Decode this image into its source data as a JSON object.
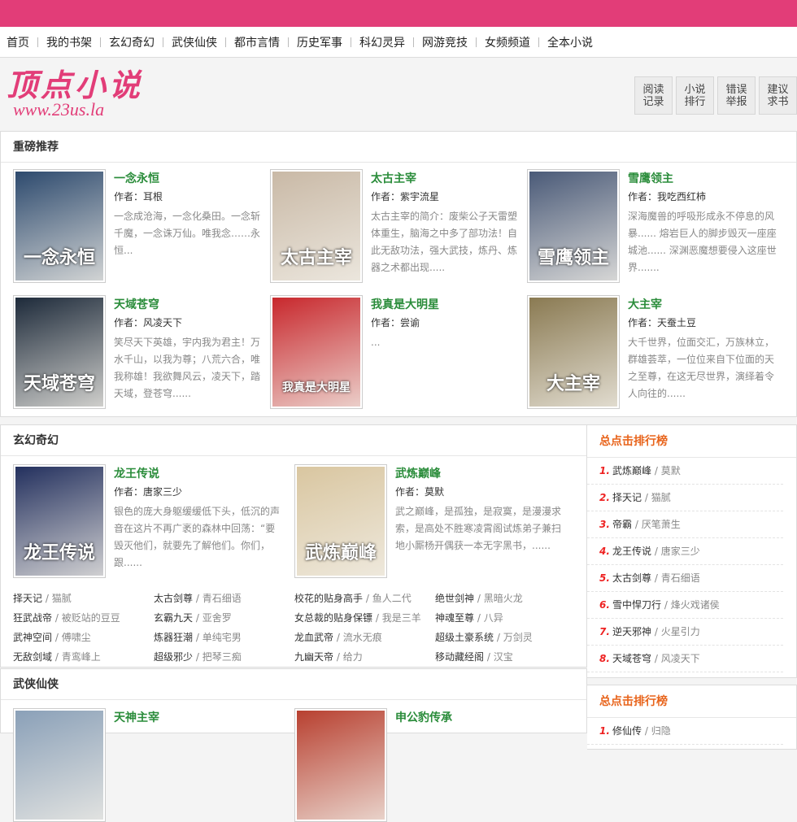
{
  "nav": [
    "首页",
    "我的书架",
    "玄幻奇幻",
    "武侠仙侠",
    "都市言情",
    "历史军事",
    "科幻灵异",
    "网游竞技",
    "女频频道",
    "全本小说"
  ],
  "logo": {
    "cn": "顶点小说",
    "en": "www.23us.la"
  },
  "quick": [
    "阅读记录",
    "小说排行",
    "错误举报",
    "建议求书"
  ],
  "recommend": {
    "title": "重磅推荐",
    "books": [
      {
        "title": "一念永恒",
        "author": "作者：耳根",
        "desc": "一念成沧海，一念化桑田。一念斩千魔，一念诛万仙。唯我念……永恒...",
        "cover_text": "一念永恒",
        "cover_color": "#2d4a6e"
      },
      {
        "title": "太古主宰",
        "author": "作者：紫宇流星",
        "desc": "太古主宰的简介：废柴公子天雷塑体重生，脑海之中多了部功法！自此无敌功法，强大武技，炼丹、炼器之术都出现.....",
        "cover_text": "太古主宰",
        "cover_color": "#c9b9a6"
      },
      {
        "title": "雪鹰领主",
        "author": "作者：我吃西红柿",
        "desc": "深海魔兽的呼吸形成永不停息的风暴...... 熔岩巨人的脚步毁灭一座座城池...... 深渊恶魔想要侵入这座世界.......",
        "cover_text": "雪鹰领主",
        "cover_color": "#4a5a78"
      },
      {
        "title": "天域苍穹",
        "author": "作者：风凌天下",
        "desc": "笑尽天下英雄，宇内我为君主！万水千山，以我为尊；八荒六合，唯我称雄！我欲舞风云，凌天下，踏天域，登苍穹......",
        "cover_text": "天域苍穹",
        "cover_color": "#1d2a3a"
      },
      {
        "title": "我真是大明星",
        "author": "作者：尝谕",
        "desc": "...",
        "cover_text": "我真是大明星",
        "cover_color": "#c8282d"
      },
      {
        "title": "大主宰",
        "author": "作者：天蚕土豆",
        "desc": "大千世界，位面交汇，万族林立，群雄荟萃，一位位来自下位面的天之至尊，在这无尽世界，演绎着令人向往的......",
        "cover_text": "大主宰",
        "cover_color": "#8a7a52"
      }
    ]
  },
  "xuanhuan": {
    "title": "玄幻奇幻",
    "books": [
      {
        "title": "龙王传说",
        "author": "作者：唐家三少",
        "desc": "银色的庞大身躯缓缓低下头，低沉的声音在这片不再广袤的森林中回荡：“要毁灭他们，就要先了解他们。你们，跟......",
        "cover_text": "龙王传说",
        "cover_color": "#23305e"
      },
      {
        "title": "武炼巅峰",
        "author": "作者：莫默",
        "desc": "武之巅峰，是孤独，是寂寞，是漫漫求索，是高处不胜寒凌霄阁试炼弟子兼扫地小厮杨开偶获一本无字黑书，......",
        "cover_text": "武炼巅峰",
        "cover_color": "#d9c6a0"
      }
    ],
    "list": [
      {
        "t": "择天记",
        "a": "猫腻"
      },
      {
        "t": "太古剑尊",
        "a": "青石细语"
      },
      {
        "t": "校花的贴身高手",
        "a": "鱼人二代"
      },
      {
        "t": "绝世剑神",
        "a": "黑暗火龙"
      },
      {
        "t": "狂武战帝",
        "a": "被贬站的豆豆"
      },
      {
        "t": "玄霸九天",
        "a": "亚舍罗"
      },
      {
        "t": "女总裁的贴身保镖",
        "a": "我是三羊"
      },
      {
        "t": "神魂至尊",
        "a": "八异"
      },
      {
        "t": "武神空间",
        "a": "傅啸尘"
      },
      {
        "t": "炼器狂潮",
        "a": "单纯宅男"
      },
      {
        "t": "龙血武帝",
        "a": "流水无痕"
      },
      {
        "t": "超级土豪系统",
        "a": "万剑灵"
      },
      {
        "t": "无敌剑域",
        "a": "青鸾峰上"
      },
      {
        "t": "超级邪少",
        "a": "把琴三痴"
      },
      {
        "t": "九幽天帝",
        "a": "给力"
      },
      {
        "t": "移动藏经阁",
        "a": "汉宝"
      }
    ]
  },
  "wuxia": {
    "title": "武侠仙侠",
    "books": [
      {
        "title": "天神主宰",
        "cover_color": "#8aa0b8"
      },
      {
        "title": "申公豹传承",
        "cover_color": "#b84030"
      }
    ]
  },
  "rank1": {
    "title": "总点击排行榜",
    "items": [
      {
        "n": "1.",
        "t": "武炼巅峰",
        "a": "莫默"
      },
      {
        "n": "2.",
        "t": "择天记",
        "a": "猫腻"
      },
      {
        "n": "3.",
        "t": "帝霸",
        "a": "厌笔萧生"
      },
      {
        "n": "4.",
        "t": "龙王传说",
        "a": "唐家三少"
      },
      {
        "n": "5.",
        "t": "太古剑尊",
        "a": "青石细语"
      },
      {
        "n": "6.",
        "t": "雪中悍刀行",
        "a": "烽火戏诸侯"
      },
      {
        "n": "7.",
        "t": "逆天邪神",
        "a": "火星引力"
      },
      {
        "n": "8.",
        "t": "天域苍穹",
        "a": "风凌天下"
      }
    ]
  },
  "rank2": {
    "title": "总点击排行榜",
    "items": [
      {
        "n": "1.",
        "t": "修仙传",
        "a": "归隐"
      }
    ]
  }
}
